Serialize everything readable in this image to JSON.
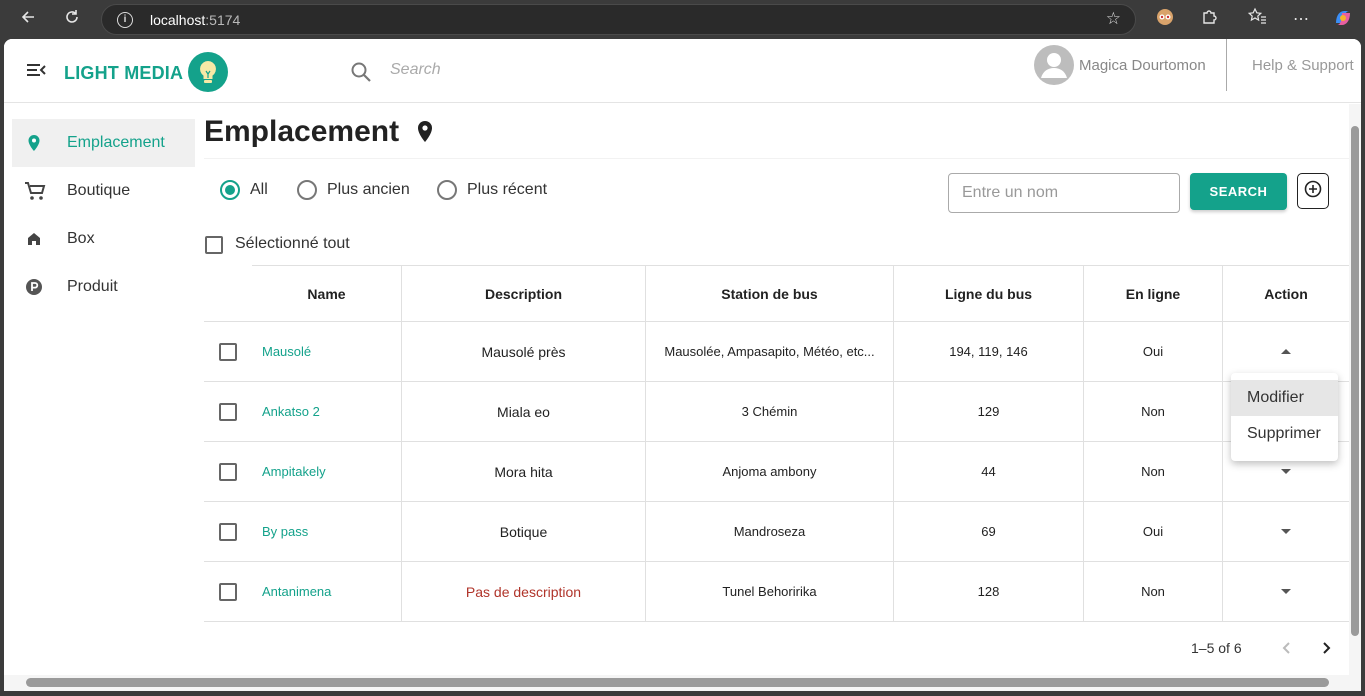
{
  "browser": {
    "url_host": "localhost",
    "url_port": ":5174"
  },
  "app": {
    "brand": "LIGHT MEDIA",
    "search_placeholder": "Search",
    "user_name": "Magica Dourtomon",
    "help_label": "Help & Support"
  },
  "sidebar": {
    "items": [
      {
        "label": "Emplacement",
        "icon": "location-pin-icon",
        "active": true
      },
      {
        "label": "Boutique",
        "icon": "cart-icon",
        "active": false
      },
      {
        "label": "Box",
        "icon": "home-icon",
        "active": false
      },
      {
        "label": "Produit",
        "icon": "parking-p-icon",
        "active": false
      }
    ]
  },
  "main": {
    "title": "Emplacement",
    "filters": [
      {
        "label": "All",
        "selected": true
      },
      {
        "label": "Plus ancien",
        "selected": false
      },
      {
        "label": "Plus récent",
        "selected": false
      }
    ],
    "name_input_placeholder": "Entre un nom",
    "search_button": "SEARCH",
    "select_all_label": "Sélectionné tout"
  },
  "table": {
    "columns": [
      "Name",
      "Description",
      "Station de bus",
      "Ligne du bus",
      "En ligne",
      "Action"
    ],
    "rows": [
      {
        "name": "Mausolé",
        "description": "Mausolé près",
        "station": "Mausolée, Ampasapito, Météo, etc...",
        "ligne": "194, 119, 146",
        "en_ligne": "Oui",
        "expanded": true
      },
      {
        "name": "Ankatso 2",
        "description": "Miala eo",
        "station": "3 Chémin",
        "ligne": "129",
        "en_ligne": "Non",
        "expanded": false
      },
      {
        "name": "Ampitakely",
        "description": "Mora hita",
        "station": "Anjoma ambony",
        "ligne": "44",
        "en_ligne": "Non",
        "expanded": false
      },
      {
        "name": "By pass",
        "description": "Botique",
        "station": "Mandroseza",
        "ligne": "69",
        "en_ligne": "Oui",
        "expanded": false
      },
      {
        "name": "Antanimena",
        "description": "Pas de description",
        "station": "Tunel Behoririka",
        "ligne": "128",
        "en_ligne": "Non",
        "expanded": false
      }
    ]
  },
  "action_menu": {
    "items": [
      "Modifier",
      "Supprimer"
    ]
  },
  "pagination": {
    "text": "1–5 of 6"
  },
  "colors": {
    "accent": "#14a28b",
    "empty_description": "#b0342a"
  }
}
